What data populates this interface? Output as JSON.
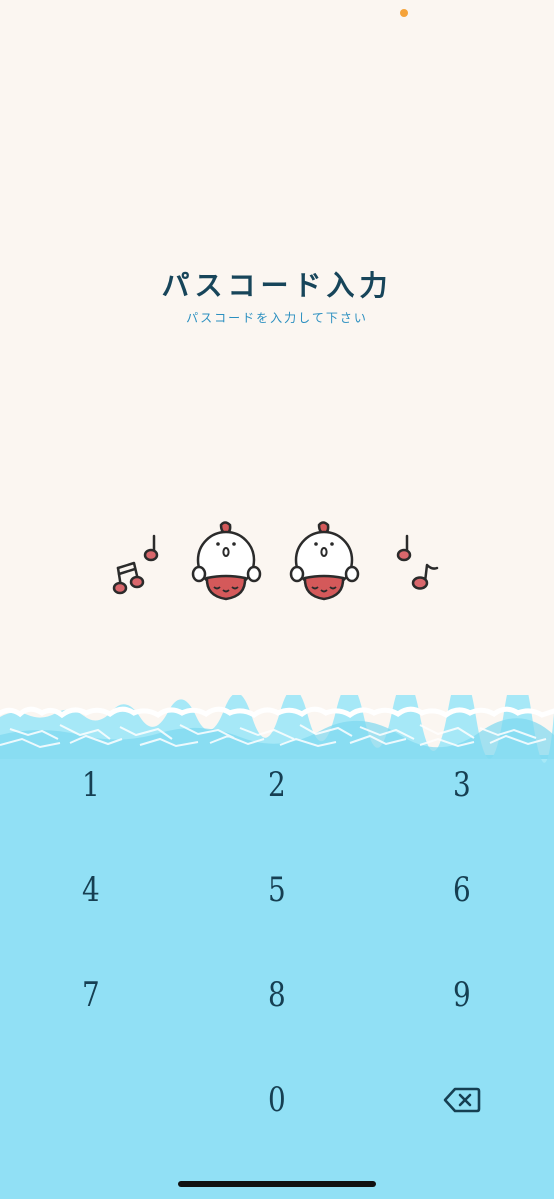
{
  "header": {
    "title": "パスコード入力",
    "subtitle": "パスコードを入力して下さい"
  },
  "passcode": {
    "entered_digits": 2,
    "total_digits": 4
  },
  "keypad": {
    "keys": [
      "1",
      "2",
      "3",
      "4",
      "5",
      "6",
      "7",
      "8",
      "9",
      "0"
    ],
    "delete_icon": "backspace-icon"
  },
  "colors": {
    "background": "#fbf6f1",
    "title": "#17455a",
    "subtitle": "#2a8fc0",
    "sea": "#91e0f5",
    "status_dot": "#f5a33a",
    "mascot_body": "#d4595a"
  }
}
